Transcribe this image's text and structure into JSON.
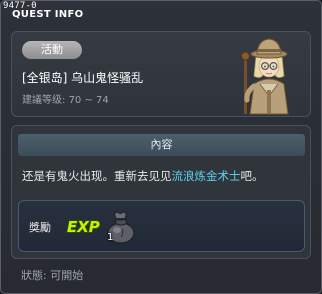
{
  "window": {
    "quest_id": "9477-0",
    "title": "QUEST INFO"
  },
  "info": {
    "category": "活動",
    "quest_name": "[全银岛] 乌山鬼怪骚乱",
    "level_label": "建議等级:",
    "level_range": "70 ~ 74"
  },
  "content": {
    "header": "內容",
    "text_before": "还是有鬼火出现。重新去见见",
    "npc_name": "流浪炼金术士",
    "text_after": "吧。",
    "npc_color": "#5fd3f0"
  },
  "reward": {
    "label": "獎勵",
    "exp_text": "EXP",
    "item_count": "1",
    "icons": [
      "exp-icon",
      "money-bag-icon"
    ]
  },
  "status": {
    "label": "狀態:",
    "value": "可開始"
  }
}
